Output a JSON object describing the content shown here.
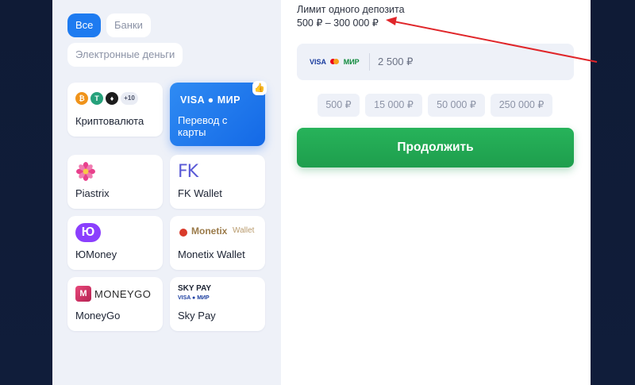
{
  "filters": [
    {
      "label": "Все",
      "active": true
    },
    {
      "label": "Банки",
      "active": false
    },
    {
      "label": "Электронные деньги",
      "active": false
    }
  ],
  "methods": [
    {
      "id": "crypto",
      "label": "Криптовалюта",
      "extra": "+10"
    },
    {
      "id": "card",
      "label": "Перевод с карты",
      "logo": "VISA ● МИР"
    },
    {
      "id": "piastrix",
      "label": "Piastrix"
    },
    {
      "id": "fk",
      "label": "FK Wallet",
      "logo": "FK"
    },
    {
      "id": "yoomoney",
      "label": "ЮMoney",
      "logo": "Ю"
    },
    {
      "id": "monetix",
      "label": "Monetix Wallet",
      "logo_main": "Monetix",
      "logo_sub": "Wallet"
    },
    {
      "id": "moneygo",
      "label": "MoneyGo",
      "logo": "MONEYGO"
    },
    {
      "id": "skypay",
      "label": "Sky Pay",
      "logo": "SKY PAY",
      "logo_sub": "VISA ● МИР"
    }
  ],
  "deposit": {
    "limit_label": "Лимит одного депозита",
    "limit_range": "500 ₽ – 300 000 ₽",
    "amount_value": "2 500 ₽",
    "card_logos": [
      "VISA",
      "МИР"
    ],
    "presets": [
      "500 ₽",
      "15 000 ₽",
      "50 000 ₽",
      "250 000 ₽"
    ],
    "submit_label": "Продолжить"
  },
  "colors": {
    "accent": "#1e7bf0",
    "cta": "#22a852",
    "annotation_arrow": "#e0262a",
    "backdrop": "#0f1b36"
  }
}
